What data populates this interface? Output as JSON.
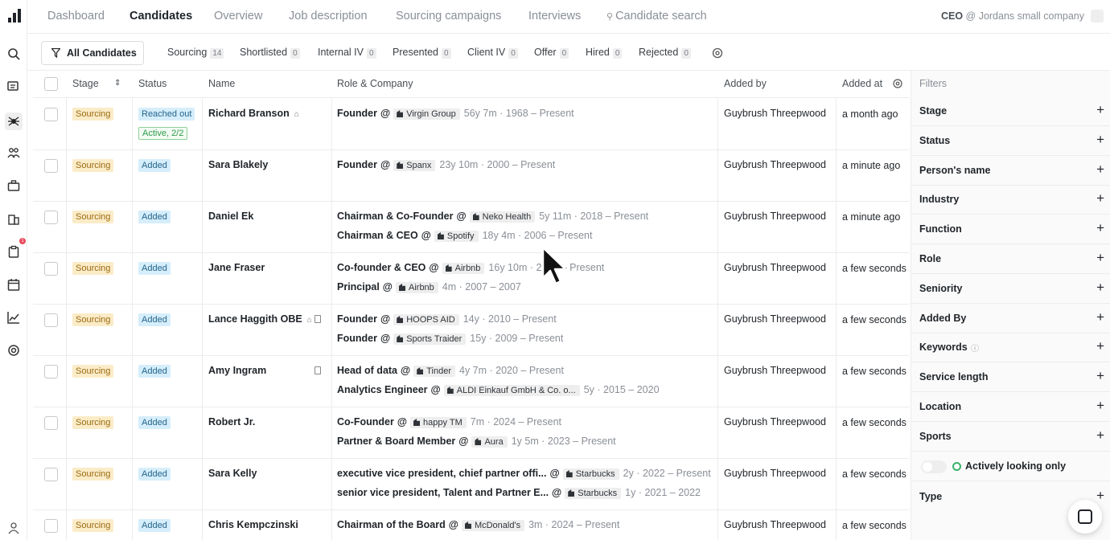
{
  "topnav": {
    "tabs": [
      {
        "label": "Dashboard"
      },
      {
        "label": "Candidates"
      },
      {
        "label": "Overview"
      },
      {
        "label": "Job description"
      },
      {
        "label": "Sourcing campaigns"
      },
      {
        "label": "Interviews"
      },
      {
        "label": "Candidate search"
      }
    ],
    "active_tab": "Candidates",
    "org_role": "CEO",
    "org_name": "@ Jordans small company"
  },
  "rail": {
    "icons": [
      "search-icon",
      "messages-icon",
      "spider-icon",
      "people-icon",
      "briefcase-icon",
      "building-icon",
      "clipboard-icon",
      "calendar-icon",
      "analytics-icon",
      "settings-icon",
      "user-icon"
    ],
    "notification_count": "1"
  },
  "stage_tabs": {
    "all_label": "All Candidates",
    "tabs": [
      {
        "label": "Sourcing",
        "count": "14"
      },
      {
        "label": "Shortlisted",
        "count": "0"
      },
      {
        "label": "Internal IV",
        "count": "0"
      },
      {
        "label": "Presented",
        "count": "0"
      },
      {
        "label": "Client IV",
        "count": "0"
      },
      {
        "label": "Offer",
        "count": "0"
      },
      {
        "label": "Hired",
        "count": "0"
      },
      {
        "label": "Rejected",
        "count": "0"
      }
    ]
  },
  "table": {
    "columns": {
      "stage": "Stage",
      "status": "Status",
      "name": "Name",
      "role": "Role & Company",
      "added_by": "Added by",
      "added_at": "Added at"
    },
    "rows": [
      {
        "stage": "Sourcing",
        "status": "Reached out",
        "status2": "Active, 2/2",
        "name": "Richard Branson",
        "roles": [
          {
            "title": "Founder",
            "company": "Virgin Group",
            "duration": "56y 7m · 1968 – Present"
          }
        ],
        "added_by": "Guybrush Threepwood",
        "added_at": "a month ago"
      },
      {
        "stage": "Sourcing",
        "status": "Added",
        "name": "Sara Blakely",
        "roles": [
          {
            "title": "Founder",
            "company": "Spanx",
            "duration": "23y 10m · 2000 – Present"
          }
        ],
        "added_by": "Guybrush Threepwood",
        "added_at": "a minute ago"
      },
      {
        "stage": "Sourcing",
        "status": "Added",
        "name": "Daniel Ek",
        "roles": [
          {
            "title": "Chairman & Co-Founder",
            "company": "Neko Health",
            "duration": "5y 11m · 2018 – Present"
          },
          {
            "title": "Chairman & CEO",
            "company": "Spotify",
            "duration": "18y 4m · 2006 – Present"
          }
        ],
        "added_by": "Guybrush Threepwood",
        "added_at": "a minute ago"
      },
      {
        "stage": "Sourcing",
        "status": "Added",
        "name": "Jane Fraser",
        "roles": [
          {
            "title": "Co-founder & CEO",
            "company": "Airbnb",
            "duration": "16y 10m · 2007 – Present"
          },
          {
            "title": "Principal",
            "company": "Airbnb",
            "duration": "4m · 2007 – 2007"
          }
        ],
        "added_by": "Guybrush Threepwood",
        "added_at": "a few seconds ago"
      },
      {
        "stage": "Sourcing",
        "status": "Added",
        "name": "Lance Haggith OBE",
        "roles": [
          {
            "title": "Founder",
            "company": "HOOPS AID",
            "duration": "14y · 2010 – Present"
          },
          {
            "title": "Founder",
            "company": "Sports Traider",
            "duration": "15y · 2009 – Present"
          }
        ],
        "added_by": "Guybrush Threepwood",
        "added_at": "a few seconds ago"
      },
      {
        "stage": "Sourcing",
        "status": "Added",
        "name": "Amy Ingram",
        "roles": [
          {
            "title": "Head of data",
            "company": "Tinder",
            "duration": "4y 7m · 2020 – Present"
          },
          {
            "title": "Analytics Engineer",
            "company": "ALDI Einkauf GmbH & Co. o...",
            "duration": "5y · 2015 – 2020"
          }
        ],
        "added_by": "Guybrush Threepwood",
        "added_at": "a few seconds ago"
      },
      {
        "stage": "Sourcing",
        "status": "Added",
        "name": "Robert Jr.",
        "roles": [
          {
            "title": "Co-Founder",
            "company": "happy TM",
            "duration": "7m · 2024 – Present"
          },
          {
            "title": "Partner & Board Member",
            "company": "Aura",
            "duration": "1y 5m · 2023 – Present"
          }
        ],
        "added_by": "Guybrush Threepwood",
        "added_at": "a few seconds ago"
      },
      {
        "stage": "Sourcing",
        "status": "Added",
        "name": "Sara Kelly",
        "roles": [
          {
            "title": "executive vice president, chief partner offi...",
            "company": "Starbucks",
            "duration": "2y · 2022 – Present"
          },
          {
            "title": "senior vice president, Talent and Partner E...",
            "company": "Starbucks",
            "duration": "1y · 2021 – 2022"
          }
        ],
        "added_by": "Guybrush Threepwood",
        "added_at": "a few seconds ago"
      },
      {
        "stage": "Sourcing",
        "status": "Added",
        "name": "Chris Kempczinski",
        "roles": [
          {
            "title": "Chairman of the Board",
            "company": "McDonald's",
            "duration": "3m · 2024 – Present"
          }
        ],
        "added_by": "Guybrush Threepwood",
        "added_at": "a few seconds ago"
      }
    ]
  },
  "filters": {
    "title": "Filters",
    "items": [
      "Stage",
      "Status",
      "Person's name",
      "Industry",
      "Function",
      "Role",
      "Seniority",
      "Added By",
      "Keywords",
      "Service length",
      "Location",
      "Sports"
    ],
    "actively_looking_label": "Actively looking only",
    "type_label": "Type",
    "plus": "+"
  }
}
